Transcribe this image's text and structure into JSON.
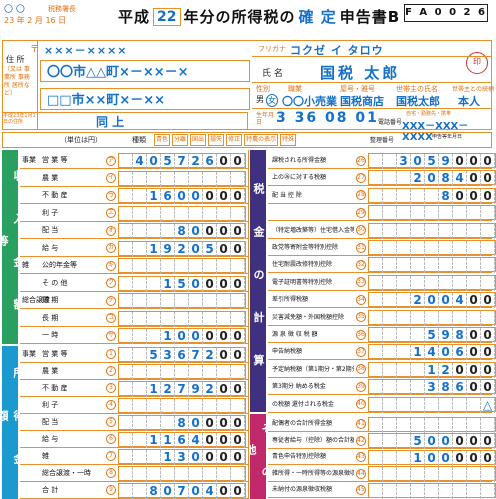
{
  "header": {
    "date_circles": "〇  〇",
    "tax_office_label": "税務署長",
    "date_line": "23 年 2 月 16 日",
    "title_prefix": "平成",
    "year": "22",
    "title_mid": "年分の所得税の",
    "title_confirm": "確 定",
    "title_suffix": "申告書B",
    "form_code": "F A 0 0 2 6"
  },
  "applicant": {
    "postal_label": "〒",
    "postal_code": "×××－××××",
    "address_label": "住 所",
    "address_sublabel": "（又は 事業所 事務所 居所など）",
    "address_value": "〇〇市△△町×－××－×",
    "address2_value": "□□市××町×－××",
    "address3_label": "平成23年1月1日の住所",
    "address3_value": "同 上",
    "furigana_label": "フリガナ",
    "furigana_value": "コクゼ イ タロウ",
    "name_label": "氏 名",
    "name_value": "国税 太郎",
    "seal_label": "印",
    "gender_label": "性別",
    "gender_male": "男",
    "gender_female": "女",
    "occupation_label": "職業",
    "occupation_value": "〇〇小売業",
    "shop_label": "屋号・雅号",
    "shop_value": "国税商店",
    "head_label": "世帯主の氏名",
    "head_value": "国税太郎",
    "relation_label": "世帯主との続柄",
    "relation_value": "本人",
    "birth_label": "生年月日",
    "birth_value": "3 36 08 01",
    "phone_label": "電話番号",
    "phone_value": "XXX－XXX－XXXX",
    "phone_sublabel": "自宅・勤務先・携帯"
  },
  "units_row": {
    "unit_label": "（単位は円）",
    "kind_label": "種類",
    "kinds": [
      "青色",
      "分離",
      "国出",
      "損失",
      "修正",
      "特農の表示",
      "特殊"
    ],
    "ref_label": "整理番号",
    "summary_label": "申告等年月日"
  },
  "income_section": {
    "side_label": "収 入 金 額 等",
    "rows": [
      {
        "group": "事業",
        "label": "営 業 等",
        "num": "ア",
        "value": "40572600"
      },
      {
        "group": "",
        "label": "農 業",
        "num": "イ",
        "value": ""
      },
      {
        "group": "",
        "label": "不 動 産",
        "num": "ウ",
        "value": "1600000"
      },
      {
        "group": "",
        "label": "利 子",
        "num": "エ",
        "value": ""
      },
      {
        "group": "",
        "label": "配 当",
        "num": "オ",
        "value": "80000"
      },
      {
        "group": "",
        "label": "給 与",
        "num": "カ",
        "value": "1920500"
      },
      {
        "group": "雑",
        "label": "公的年金等",
        "num": "キ",
        "value": ""
      },
      {
        "group": "",
        "label": "そ の 他",
        "num": "ク",
        "value": "150000"
      },
      {
        "group": "総合譲渡",
        "label": "短 期",
        "num": "ケ",
        "value": ""
      },
      {
        "group": "",
        "label": "長 期",
        "num": "コ",
        "value": ""
      },
      {
        "group": "",
        "label": "一 時",
        "num": "サ",
        "value": "100000"
      }
    ]
  },
  "earnings_section": {
    "side_label": "所 得 金 額",
    "rows": [
      {
        "group": "事業",
        "label": "営 業 等",
        "num": "1",
        "value": "5367200"
      },
      {
        "group": "",
        "label": "農 業",
        "num": "2",
        "value": ""
      },
      {
        "group": "",
        "label": "不 動 産",
        "num": "3",
        "value": "1279200"
      },
      {
        "group": "",
        "label": "利 子",
        "num": "4",
        "value": ""
      },
      {
        "group": "",
        "label": "配 当",
        "num": "5",
        "value": "80000"
      },
      {
        "group": "",
        "label": "給 与",
        "num": "6",
        "value": "1164000"
      },
      {
        "group": "",
        "label": "雑",
        "num": "7",
        "value": "130000"
      },
      {
        "group": "",
        "label": "総合譲渡・一時",
        "num": "8",
        "value": ""
      },
      {
        "group": "",
        "label": "合 計",
        "num": "9",
        "value": "8070400"
      }
    ]
  },
  "tax_section": {
    "side_label": "税 金 の 計 算",
    "rows": [
      {
        "label": "課税される所得金額",
        "num": "26",
        "value": "3059000"
      },
      {
        "label": "上の㉖に対する税額",
        "num": "27",
        "value": "208400"
      },
      {
        "label": "配 当 控 除",
        "num": "28",
        "value": "8000"
      },
      {
        "label": "",
        "num": "29",
        "value": ""
      },
      {
        "label": "（特定増改築等）住宅借入金等特別控除",
        "num": "30",
        "value": ""
      },
      {
        "label": "政党等寄附金等特別控除",
        "num": "31",
        "value": ""
      },
      {
        "label": "住宅耐震改修特別控除",
        "num": "32",
        "value": ""
      },
      {
        "label": "電子証明書等特別控除",
        "num": "33",
        "value": ""
      },
      {
        "label": "差引所得税額",
        "num": "34",
        "value": "200400"
      },
      {
        "label": "災害減免額・外国税額控除",
        "num": "35",
        "value": ""
      },
      {
        "label": "源 泉 徴 収 税 額",
        "num": "36",
        "value": "59800"
      },
      {
        "label": "申告納税額",
        "num": "37",
        "value": "140600"
      },
      {
        "label": "予定納税額（第1期分・第2期分）",
        "num": "38",
        "value": "12000"
      },
      {
        "label": "第3期分 納める税金",
        "num": "39",
        "value": "38600"
      },
      {
        "label": "の税額 還付される税金",
        "num": "40",
        "value": "△"
      }
    ]
  },
  "other_section": {
    "side_label": "そ の 他",
    "rows": [
      {
        "label": "配偶者の合計所得金額",
        "num": "41",
        "value": ""
      },
      {
        "label": "専従者給与（控除）額の合計額",
        "num": "42",
        "value": "500000"
      },
      {
        "label": "青色申告特別控除額",
        "num": "43",
        "value": "100000"
      },
      {
        "label": "雑所得・一時所得等の源泉徴収税額の合計額",
        "num": "44",
        "value": ""
      },
      {
        "label": "未納付の源泉徴収税額",
        "num": "45",
        "value": ""
      }
    ]
  },
  "colors": {
    "accent_orange": "#e8902a",
    "blue_ink": "#1570c8",
    "green_bar": "#2aa060",
    "purple_bar": "#403080",
    "magenta_bar": "#c02a6a",
    "cyan_bar": "#1b9ad0"
  }
}
